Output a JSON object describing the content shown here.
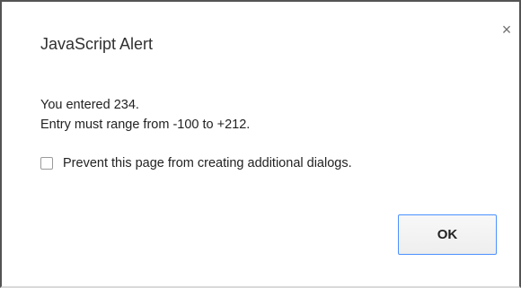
{
  "dialog": {
    "title": "JavaScript Alert",
    "close_symbol": "×",
    "message_lines": [
      "You entered 234.",
      "Entry must range from -100 to +212."
    ],
    "suppress_label": "Prevent this page from creating additional dialogs.",
    "suppress_checked": false,
    "ok_label": "OK"
  },
  "colors": {
    "ok_border": "#4d90fe"
  },
  "icons": {
    "close": "close-icon"
  }
}
